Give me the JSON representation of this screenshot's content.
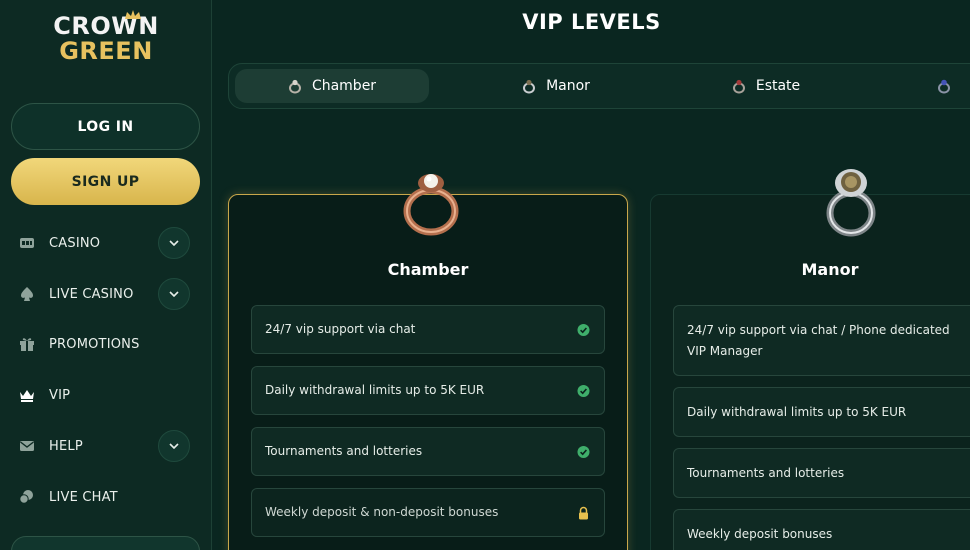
{
  "brand": {
    "line1": "CROWN",
    "line2": "GREEN"
  },
  "auth": {
    "login_label": "LOG IN",
    "signup_label": "SIGN UP"
  },
  "nav": [
    {
      "label": "CASINO",
      "icon": "slot-machine-icon",
      "expandable": true
    },
    {
      "label": "LIVE CASINO",
      "icon": "spade-icon",
      "expandable": true
    },
    {
      "label": "PROMOTIONS",
      "icon": "gift-icon",
      "expandable": false
    },
    {
      "label": "VIP",
      "icon": "crown-icon",
      "expandable": false
    },
    {
      "label": "HELP",
      "icon": "mail-icon",
      "expandable": true
    },
    {
      "label": "LIVE CHAT",
      "icon": "chat-icon",
      "expandable": false
    }
  ],
  "page": {
    "title": "VIP LEVELS"
  },
  "tabs": [
    {
      "label": "Chamber",
      "icon": "ring-icon",
      "active": true
    },
    {
      "label": "Manor",
      "icon": "ring-icon",
      "active": false
    },
    {
      "label": "Estate",
      "icon": "ring-icon",
      "active": false
    },
    {
      "label": "",
      "icon": "ring-icon",
      "active": false
    }
  ],
  "levels": [
    {
      "name": "Chamber",
      "ring": "rose-gold-ring-icon",
      "features": [
        {
          "text": "24/7 vip support via chat",
          "status": "check-icon"
        },
        {
          "text": "Daily withdrawal limits up to 5K EUR",
          "status": "check-icon"
        },
        {
          "text": "Tournaments and lotteries",
          "status": "check-icon"
        },
        {
          "text": "Weekly deposit & non-deposit bonuses",
          "status": "lock-icon"
        }
      ]
    },
    {
      "name": "Manor",
      "ring": "silver-ring-icon",
      "features": [
        {
          "text": "24/7 vip support via chat / Phone dedicated VIP Manager"
        },
        {
          "text": "Daily withdrawal limits up to 5K EUR"
        },
        {
          "text": "Tournaments and lotteries"
        },
        {
          "text": "Weekly deposit bonuses"
        }
      ]
    }
  ],
  "colors": {
    "background": "#0a2620",
    "sidebar": "#0d2a23",
    "gold": "#e7c15f",
    "check": "#3fae6b",
    "lock": "#e8c14e"
  }
}
